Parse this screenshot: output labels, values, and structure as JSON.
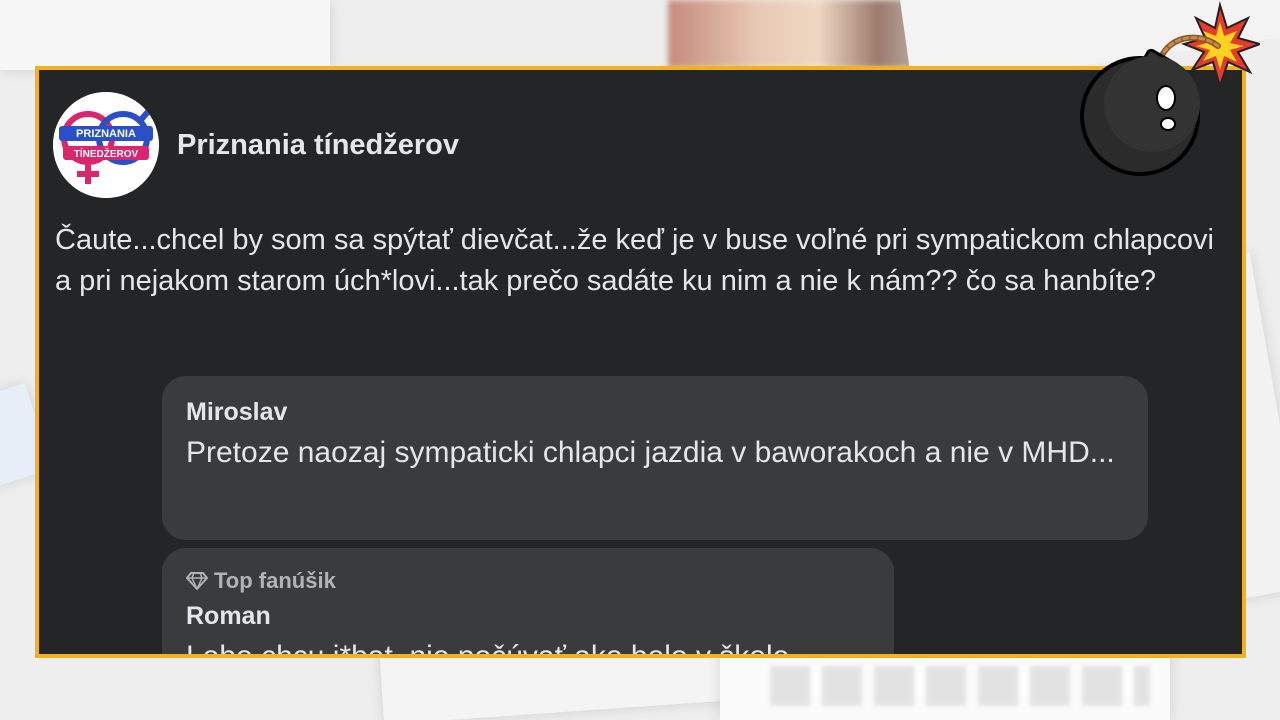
{
  "page": {
    "name": "Priznania tínedžerov",
    "avatar_text_top": "PRIZNANIA",
    "avatar_text_bottom": "TÍNEDŽEROV"
  },
  "post": {
    "text": "Čaute...chcel by som sa spýtať dievčat...že keď je v buse voľné pri sympatickom chlapcovi a pri nejakom starom úch*lovi...tak prečo sadáte ku nim a nie k nám?? čo sa hanbíte?"
  },
  "comments": [
    {
      "author": "Miroslav",
      "text": "Pretoze naozaj sympaticki chlapci jazdia v baworakoch a nie v MHD..."
    },
    {
      "badge": "Top fanúšik",
      "author": "Roman",
      "text": "Lebo chcu j*bat, nie počúvať ako bolo v škole"
    }
  ],
  "colors": {
    "frame_border": "#f2b21b",
    "post_bg": "#242526",
    "comment_bg": "#3a3b3c",
    "text": "#e4e6eb",
    "muted": "#b0b3b8"
  },
  "icons": [
    "diamond-icon",
    "bomb-icon"
  ]
}
